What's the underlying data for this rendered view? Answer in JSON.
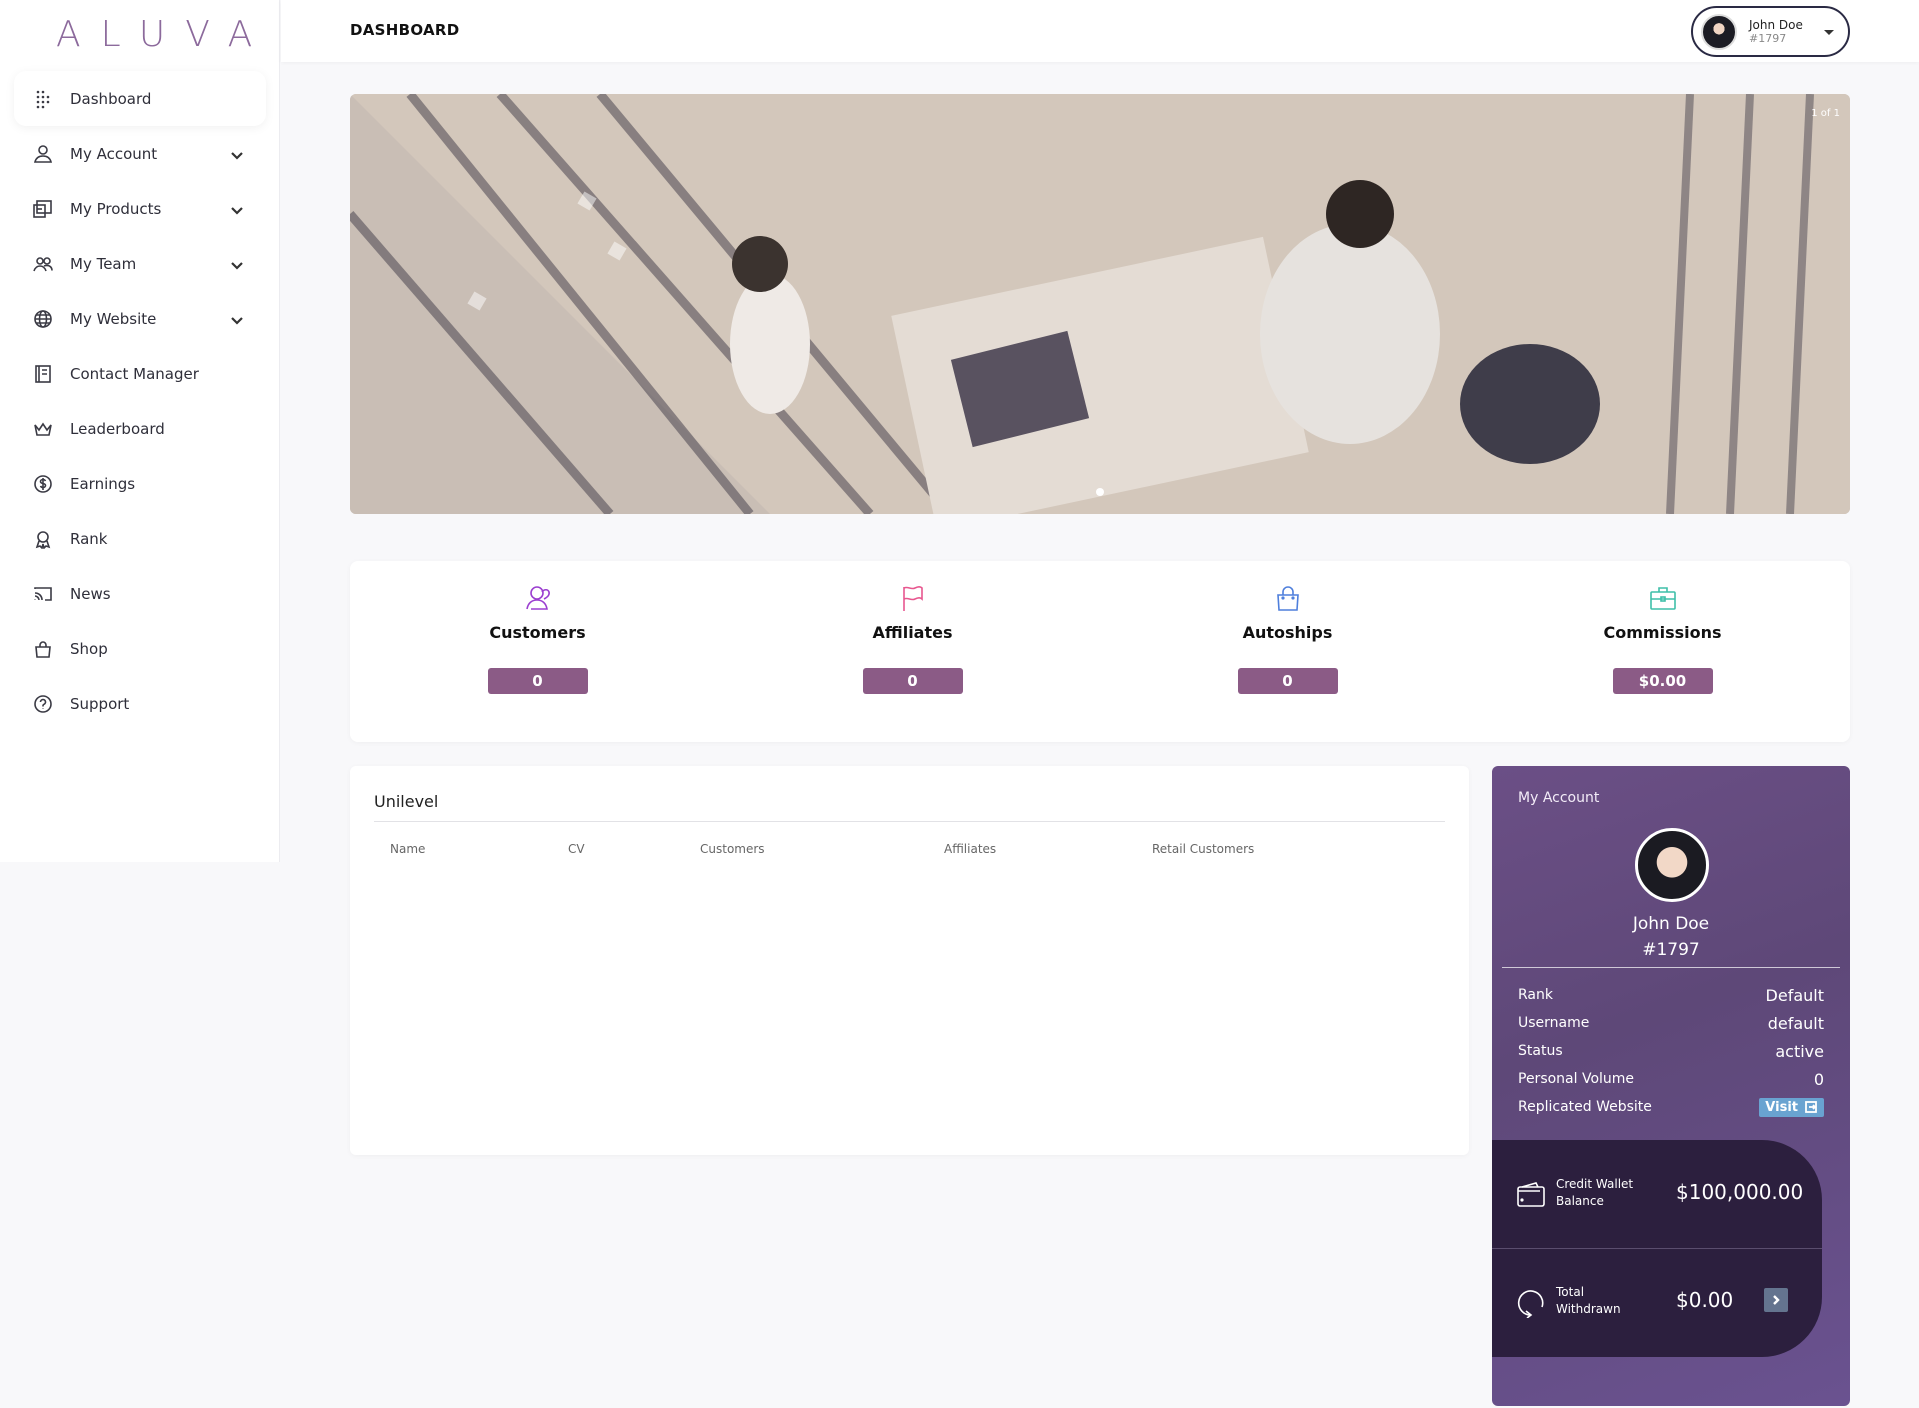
{
  "brand": {
    "logo": "ALUVA"
  },
  "sidebar": {
    "items": [
      {
        "label": "Dashboard",
        "icon": "grid-dots-icon",
        "active": true
      },
      {
        "label": "My Account",
        "icon": "user-icon",
        "expandable": true
      },
      {
        "label": "My Products",
        "icon": "products-icon",
        "expandable": true
      },
      {
        "label": "My Team",
        "icon": "team-icon",
        "expandable": true
      },
      {
        "label": "My Website",
        "icon": "globe-icon",
        "expandable": true
      },
      {
        "label": "Contact Manager",
        "icon": "contacts-icon"
      },
      {
        "label": "Leaderboard",
        "icon": "crown-icon"
      },
      {
        "label": "Earnings",
        "icon": "dollar-icon"
      },
      {
        "label": "Rank",
        "icon": "award-icon"
      },
      {
        "label": "News",
        "icon": "cast-icon"
      },
      {
        "label": "Shop",
        "icon": "bag-icon"
      },
      {
        "label": "Support",
        "icon": "help-icon"
      }
    ]
  },
  "header": {
    "title": "DASHBOARD",
    "user": {
      "name": "John Doe",
      "id": "#1797"
    }
  },
  "banner": {
    "counter": "1 of 1"
  },
  "stats": [
    {
      "label": "Customers",
      "value": "0",
      "icon": "customers-icon",
      "color": "#9b3fd0"
    },
    {
      "label": "Affiliates",
      "value": "0",
      "icon": "flag-icon",
      "color": "#e8578f"
    },
    {
      "label": "Autoships",
      "value": "0",
      "icon": "shopping-bag-icon",
      "color": "#4f7fdc"
    },
    {
      "label": "Commissions",
      "value": "$0.00",
      "icon": "briefcase-icon",
      "color": "#3fbfa9"
    }
  ],
  "unilevel": {
    "title": "Unilevel",
    "columns": [
      "Name",
      "CV",
      "Customers",
      "Affiliates",
      "Retail Customers"
    ]
  },
  "account": {
    "title": "My Account",
    "name": "John Doe",
    "id": "#1797",
    "rows": [
      {
        "key": "Rank",
        "value": "Default"
      },
      {
        "key": "Username",
        "value": "default"
      },
      {
        "key": "Status",
        "value": "active"
      },
      {
        "key": "Personal Volume",
        "value": "0"
      },
      {
        "key": "Replicated Website",
        "value": "Visit"
      }
    ],
    "wallet": {
      "credit_label": "Credit Wallet Balance",
      "credit_value": "$100,000.00",
      "withdrawn_label": "Total Withdrawn",
      "withdrawn_value": "$0.00"
    }
  },
  "colors": {
    "brand": "#8c6a9c",
    "stat_badge": "#8b5b86",
    "card": "#5e4878",
    "wallet": "#2c1f3e"
  }
}
